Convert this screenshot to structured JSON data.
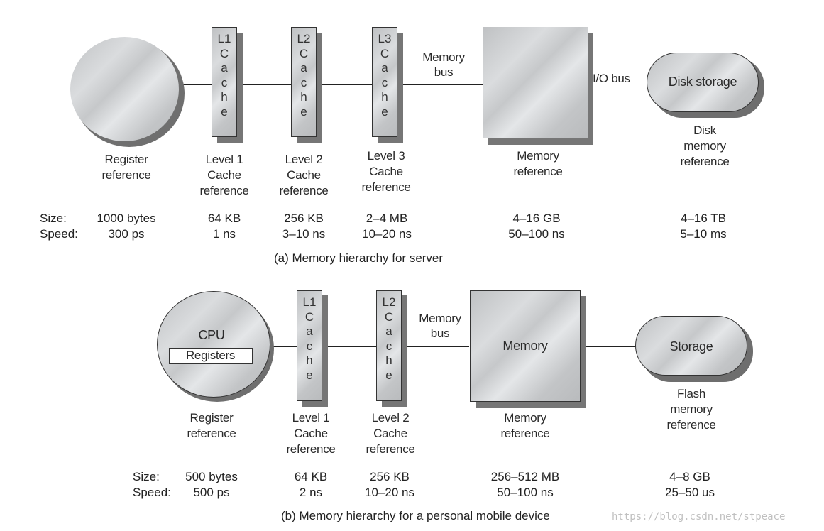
{
  "diagram_a": {
    "caption": "(a) Memory hierarchy for server",
    "bus_labels": {
      "memory_bus": "Memory\nbus",
      "io_bus": "I/O bus"
    },
    "components": [
      {
        "name": "register",
        "shape_label": "",
        "reference": "Register\nreference",
        "size": "1000 bytes",
        "speed": "300 ps"
      },
      {
        "name": "l1",
        "shape_label": "L1\nC\na\nc\nh\ne",
        "reference": "Level 1\nCache\nreference",
        "size": "64 KB",
        "speed": "1 ns"
      },
      {
        "name": "l2",
        "shape_label": "L2\nC\na\nc\nh\ne",
        "reference": "Level 2\nCache\nreference",
        "size": "256 KB",
        "speed": "3–10 ns"
      },
      {
        "name": "l3",
        "shape_label": "L3\nC\na\nc\nh\ne",
        "reference": "Level 3\nCache\nreference",
        "size": "2–4 MB",
        "speed": "10–20 ns"
      },
      {
        "name": "memory",
        "shape_label": "",
        "reference": "Memory\nreference",
        "size": "4–16 GB",
        "speed": "50–100 ns"
      },
      {
        "name": "disk",
        "shape_label": "Disk storage",
        "reference": "Disk\nmemory\nreference",
        "size": "4–16 TB",
        "speed": "5–10 ms"
      }
    ],
    "row_labels": {
      "size": "Size:",
      "speed": "Speed:"
    }
  },
  "diagram_b": {
    "caption": "(b) Memory hierarchy for a personal mobile device",
    "bus_labels": {
      "memory_bus": "Memory\nbus"
    },
    "cpu_label": "CPU",
    "registers_label": "Registers",
    "components": [
      {
        "name": "register",
        "shape_label": "",
        "reference": "Register\nreference",
        "size": "500 bytes",
        "speed": "500 ps"
      },
      {
        "name": "l1",
        "shape_label": "L1\nC\na\nc\nh\ne",
        "reference": "Level 1\nCache\nreference",
        "size": "64 KB",
        "speed": "2 ns"
      },
      {
        "name": "l2",
        "shape_label": "L2\nC\na\nc\nh\ne",
        "reference": "Level 2\nCache\nreference",
        "size": "256 KB",
        "speed": "10–20 ns"
      },
      {
        "name": "memory",
        "shape_label": "Memory",
        "reference": "Memory\nreference",
        "size": "256–512 MB",
        "speed": "50–100 ns"
      },
      {
        "name": "storage",
        "shape_label": "Storage",
        "reference": "Flash\nmemory\nreference",
        "size": "4–8 GB",
        "speed": "25–50 us"
      }
    ],
    "row_labels": {
      "size": "Size:",
      "speed": "Speed:"
    }
  },
  "watermark": "https://blog.csdn.net/stpeace"
}
